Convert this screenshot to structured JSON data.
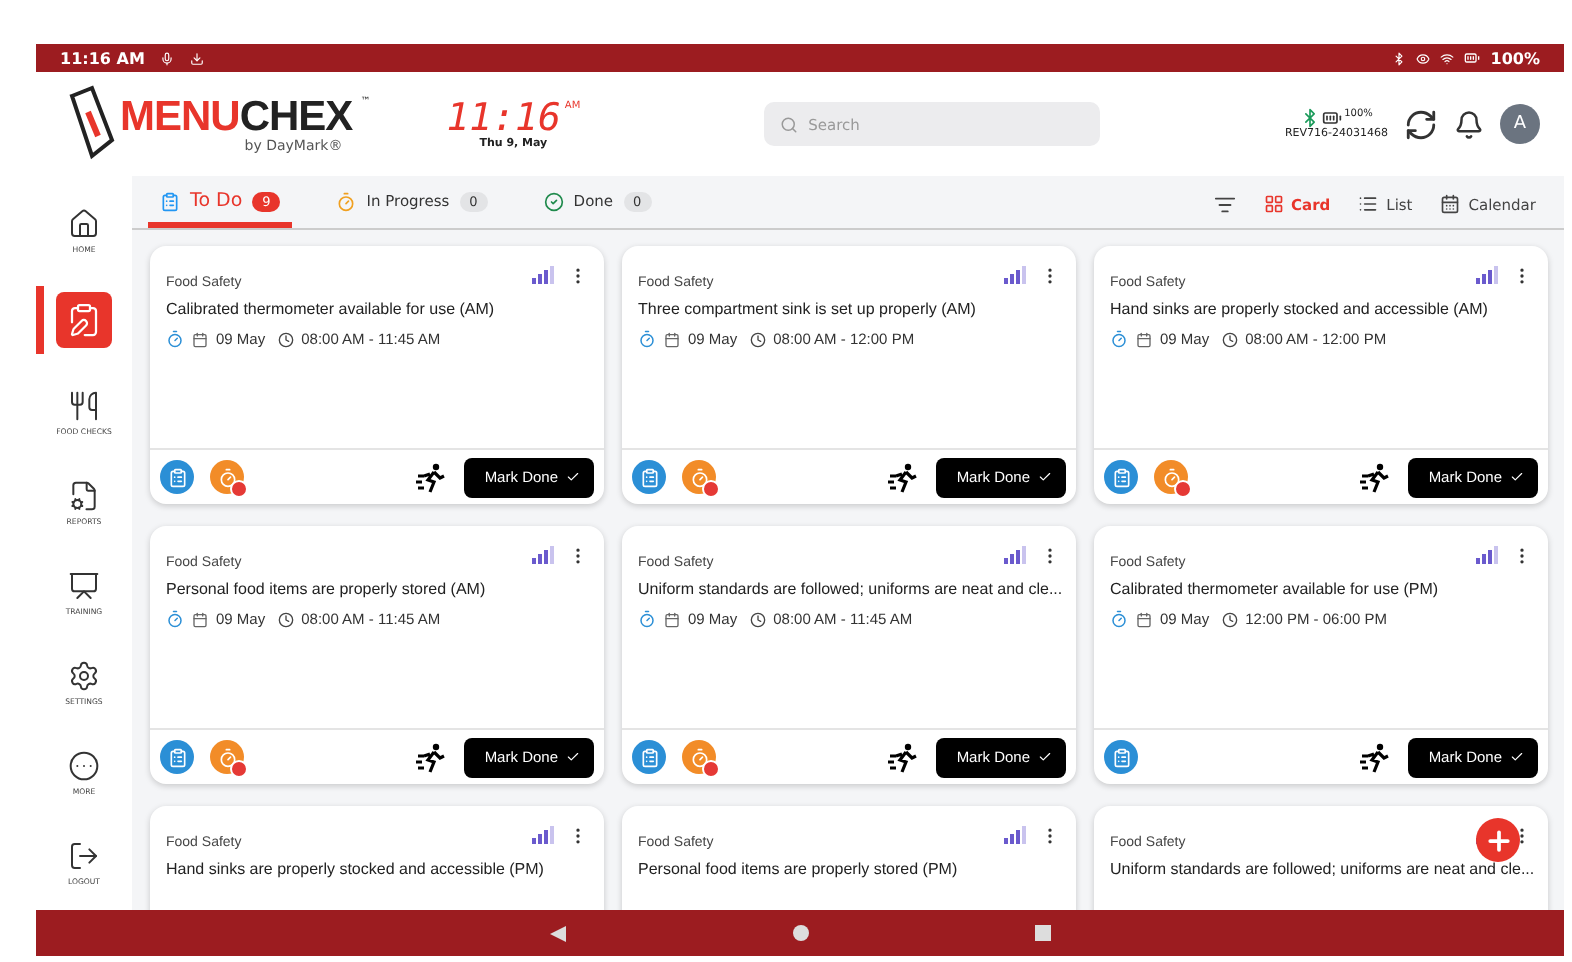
{
  "status_bar": {
    "time": "11:16 AM",
    "battery": "100%"
  },
  "header": {
    "logo": {
      "brand_red": "MENU",
      "brand_dark": "CHEX",
      "trademark": "™",
      "byline": "by DayMark®"
    },
    "clock": {
      "time": "11:16",
      "meridiem": "AM",
      "date": "Thu 9, May"
    },
    "search": {
      "placeholder": "Search"
    },
    "device": {
      "battery": "100%",
      "id": "REV716-24031468"
    },
    "avatar": "A"
  },
  "sidebar": {
    "items": [
      {
        "kind": "home",
        "label": "HOME",
        "selected": false
      },
      {
        "kind": "tasks",
        "selected": true
      },
      {
        "kind": "food",
        "label": "FOOD CHECKS",
        "selected": false
      },
      {
        "kind": "reports",
        "label": "REPORTS",
        "selected": false
      },
      {
        "kind": "training",
        "label": "TRAINING",
        "selected": false
      },
      {
        "kind": "settings",
        "label": "SETTINGS",
        "selected": false
      },
      {
        "kind": "more",
        "label": "MORE",
        "selected": false
      },
      {
        "kind": "logout",
        "label": "LOGOUT",
        "selected": false
      }
    ]
  },
  "tabs": [
    {
      "kind": "todo",
      "label": "To Do",
      "count": "9",
      "selected": true
    },
    {
      "kind": "progress",
      "label": "In Progress",
      "count": "0",
      "selected": false
    },
    {
      "kind": "done",
      "label": "Done",
      "count": "0",
      "selected": false
    }
  ],
  "views": [
    {
      "kind": "card",
      "label": "Card",
      "selected": true
    },
    {
      "kind": "list",
      "label": "List",
      "selected": false
    },
    {
      "kind": "calendar",
      "label": "Calendar",
      "selected": false
    }
  ],
  "cards": [
    {
      "category": "Food Safety",
      "title": "Calibrated thermometer available for use (AM)",
      "date": "09 May",
      "time": "08:00 AM - 11:45 AM",
      "overdue": true,
      "action": "Mark Done"
    },
    {
      "category": "Food Safety",
      "title": "Three compartment sink is set up properly (AM)",
      "date": "09 May",
      "time": "08:00 AM - 12:00 PM",
      "overdue": true,
      "action": "Mark Done"
    },
    {
      "category": "Food Safety",
      "title": "Hand sinks are properly stocked and accessible (AM)",
      "date": "09 May",
      "time": "08:00 AM - 12:00 PM",
      "overdue": true,
      "action": "Mark Done"
    },
    {
      "category": "Food Safety",
      "title": "Personal food items are properly stored (AM)",
      "date": "09 May",
      "time": "08:00 AM - 11:45 AM",
      "overdue": true,
      "action": "Mark Done"
    },
    {
      "category": "Food Safety",
      "title": "Uniform standards are followed; uniforms are neat and cle...",
      "date": "09 May",
      "time": "08:00 AM - 11:45 AM",
      "overdue": true,
      "action": "Mark Done"
    },
    {
      "category": "Food Safety",
      "title": "Calibrated thermometer available for use (PM)",
      "date": "09 May",
      "time": "12:00 PM - 06:00 PM",
      "overdue": false,
      "action": "Mark Done"
    },
    {
      "category": "Food Safety",
      "title": "Hand sinks are properly stocked and accessible (PM)"
    },
    {
      "category": "Food Safety",
      "title": "Personal food items are properly stored (PM)"
    },
    {
      "category": "Food Safety",
      "title": "Uniform standards are followed; uniforms are neat and cle..."
    }
  ]
}
